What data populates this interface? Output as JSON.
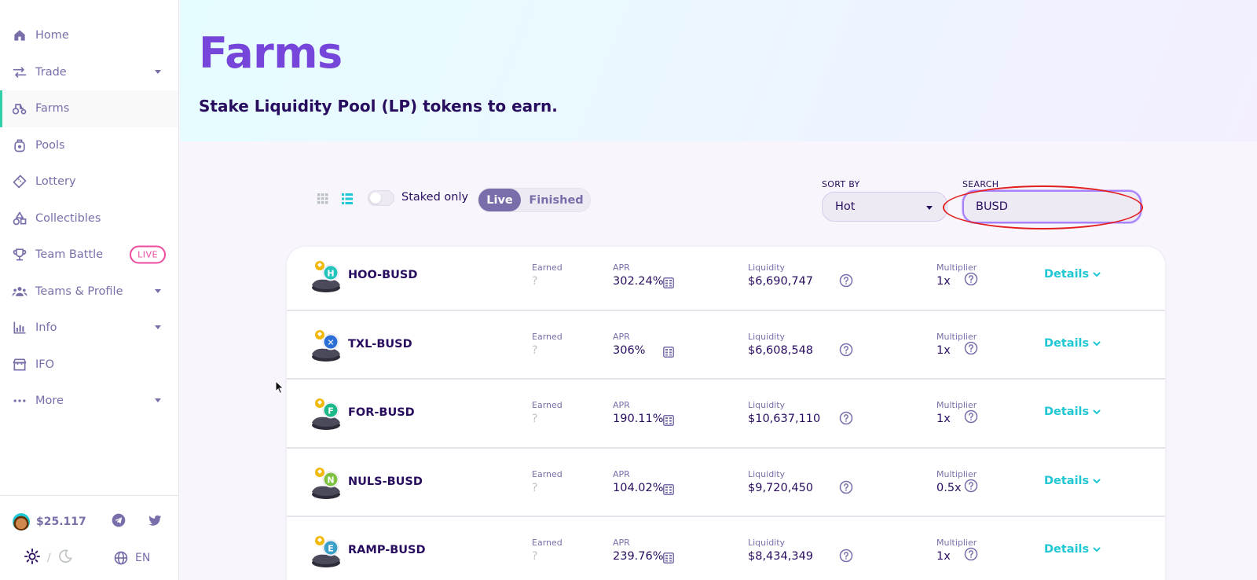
{
  "sidebar": {
    "items": [
      {
        "label": "Home",
        "icon": "home-icon"
      },
      {
        "label": "Trade",
        "icon": "trade-icon",
        "has_submenu": true
      },
      {
        "label": "Farms",
        "icon": "farm-icon",
        "active": true
      },
      {
        "label": "Pools",
        "icon": "pool-icon"
      },
      {
        "label": "Lottery",
        "icon": "ticket-icon"
      },
      {
        "label": "Collectibles",
        "icon": "shapes-icon"
      },
      {
        "label": "Team Battle",
        "icon": "trophy-icon",
        "badge": "LIVE"
      },
      {
        "label": "Teams & Profile",
        "icon": "groups-icon",
        "has_submenu": true
      },
      {
        "label": "Info",
        "icon": "chart-icon",
        "has_submenu": true
      },
      {
        "label": "IFO",
        "icon": "ifo-icon"
      },
      {
        "label": "More",
        "icon": "more-icon",
        "has_submenu": true
      }
    ],
    "footer": {
      "cake_price": "$25.117",
      "theme_separator": "/",
      "language": "EN"
    }
  },
  "hero": {
    "title": "Farms",
    "subtitle": "Stake Liquidity Pool (LP) tokens to earn."
  },
  "controls": {
    "staked_only_label": "Staked only",
    "tab_live": "Live",
    "tab_finished": "Finished",
    "sort_label": "SORT BY",
    "sort_value": "Hot",
    "search_label": "SEARCH",
    "search_value": "BUSD"
  },
  "table": {
    "labels": {
      "earned": "Earned",
      "apr": "APR",
      "liquidity": "Liquidity",
      "multiplier": "Multiplier",
      "details": "Details"
    },
    "rows": [
      {
        "pair": "HOO-BUSD",
        "earned": "?",
        "apr": "302.24%",
        "liquidity": "$6,690,747",
        "multiplier": "1x",
        "token_letter": "H",
        "token_color": "#22c3bb"
      },
      {
        "pair": "TXL-BUSD",
        "earned": "?",
        "apr": "306%",
        "liquidity": "$6,608,548",
        "multiplier": "1x",
        "token_letter": "✕",
        "token_color": "#2b6fd6"
      },
      {
        "pair": "FOR-BUSD",
        "earned": "?",
        "apr": "190.11%",
        "liquidity": "$10,637,110",
        "multiplier": "1x",
        "token_letter": "F",
        "token_color": "#1fb88a"
      },
      {
        "pair": "NULS-BUSD",
        "earned": "?",
        "apr": "104.02%",
        "liquidity": "$9,720,450",
        "multiplier": "0.5x",
        "token_letter": "N",
        "token_color": "#7fc242"
      },
      {
        "pair": "RAMP-BUSD",
        "earned": "?",
        "apr": "239.76%",
        "liquidity": "$8,434,349",
        "multiplier": "1x",
        "token_letter": "E",
        "token_color": "#3aa0c8"
      }
    ]
  },
  "colors": {
    "accent_purple": "#7645d9",
    "text_primary": "#280d5f",
    "text_secondary": "#7a6eaa",
    "primary_teal": "#1fc7d4",
    "active_indicator": "#31d0aa",
    "live_pink": "#ed4b9e",
    "annotation_red": "#e21f1f"
  }
}
